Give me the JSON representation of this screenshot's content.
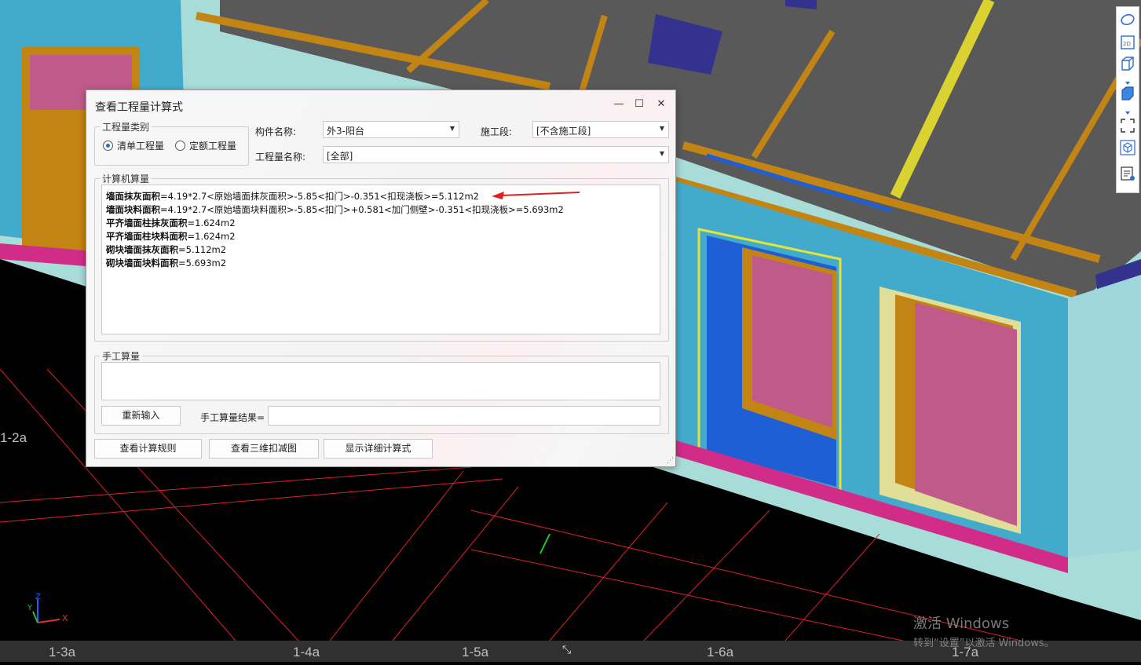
{
  "dialog": {
    "title": "查看工程量计算式",
    "window_controls": {
      "minimize": "—",
      "maximize": "☐",
      "close": "✕"
    },
    "quantity_type": {
      "group_label": "工程量类别",
      "options": [
        {
          "label": "清单工程量",
          "checked": true
        },
        {
          "label": "定额工程量",
          "checked": false
        }
      ]
    },
    "component_name": {
      "label": "构件名称:",
      "value": "外3-阳台"
    },
    "construction_stage": {
      "label": "施工段:",
      "value": "[不含施工段]"
    },
    "quantity_name": {
      "label": "工程量名称:",
      "value": "[全部]"
    },
    "computer_calc": {
      "group_label": "计算机算量",
      "lines": [
        {
          "name": "墙面抹灰面积",
          "formula": "=4.19*2.7<原始墙面抹灰面积>-5.85<扣门>-0.351<扣现浇板>=5.112m2"
        },
        {
          "name": "墙面块料面积",
          "formula": "=4.19*2.7<原始墙面块料面积>-5.85<扣门>+0.581<加门侧壁>-0.351<扣现浇板>=5.693m2"
        },
        {
          "name": "平齐墙面柱抹灰面积",
          "formula": "=1.624m2"
        },
        {
          "name": "平齐墙面柱块料面积",
          "formula": "=1.624m2"
        },
        {
          "name": "砌块墙面抹灰面积",
          "formula": "=5.112m2"
        },
        {
          "name": "砌块墙面块料面积",
          "formula": "=5.693m2"
        }
      ]
    },
    "manual_calc": {
      "group_label": "手工算量",
      "input_value": "",
      "reenter_button": "重新输入",
      "result_label": "手工算量结果=",
      "result_value": ""
    },
    "buttons": {
      "view_rules": "查看计算规则",
      "view_3d": "查看三维扣减图",
      "show_detail": "显示详细计算式"
    }
  },
  "viewport": {
    "grid_labels_bottom": [
      "1-3a",
      "1-4a",
      "1-5a",
      "1-6a",
      "1-7a"
    ],
    "grid_label_left": "1-2a",
    "triad_axes": [
      "Z",
      "Y",
      "X"
    ],
    "colors": {
      "wall": "#42abcc",
      "floor": "#a8dcd9",
      "slab": "#595959",
      "beam": "#c28412",
      "window_frame": "#e0df9a",
      "glass": "#c05a8a",
      "selection": "#e6e33a",
      "grid": "#e0202a"
    }
  },
  "toolbar": {
    "icons": [
      "orbit-icon",
      "2d-view-icon",
      "3d-box-icon",
      "dropdown-arrow-icon",
      "solid-box-icon",
      "dropdown-arrow-icon",
      "fullscreen-icon",
      "cube-view-icon",
      "report-icon"
    ],
    "labels": {
      "2d": "2D"
    }
  },
  "watermark": {
    "line1": "激活 Windows",
    "line2": "转到“设置”以激活 Windows。"
  }
}
